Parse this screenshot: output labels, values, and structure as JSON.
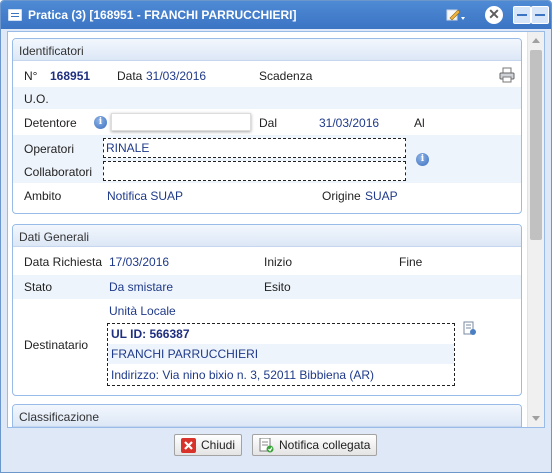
{
  "window": {
    "title": "Pratica (3) [168951 - FRANCHI PARRUCCHIERI]"
  },
  "identificatori": {
    "header": "Identificatori",
    "n_label": "N°",
    "n_value": "168951",
    "data_label": "Data",
    "data_value": "31/03/2016",
    "scadenza_label": "Scadenza",
    "uo_label": "U.O.",
    "detentore_label": "Detentore",
    "dal_label": "Dal",
    "dal_value": "31/03/2016",
    "al_label": "Al",
    "operatori_label": "Operatori",
    "operatori_value": "RINALE",
    "collaboratori_label": "Collaboratori",
    "ambito_label": "Ambito",
    "ambito_value": "Notifica SUAP",
    "origine_label": "Origine",
    "origine_value": "SUAP"
  },
  "dati_generali": {
    "header": "Dati Generali",
    "data_richiesta_label": "Data Richiesta",
    "data_richiesta_value": "17/03/2016",
    "inizio_label": "Inizio",
    "fine_label": "Fine",
    "stato_label": "Stato",
    "stato_value": "Da smistare",
    "esito_label": "Esito",
    "unita_value": "Unità Locale",
    "destinatario_label": "Destinatario",
    "ul_id": "UL ID: 566387",
    "ragione_sociale": "FRANCHI PARRUCCHIERI",
    "indirizzo": "Indirizzo: Via nino bixio n. 3, 52011 Bibbiena (AR)"
  },
  "classificazione": {
    "header": "Classificazione"
  },
  "footer": {
    "chiudi_label": "Chiudi",
    "notifica_label": "Notifica collegata"
  },
  "icons": {
    "info": "info-icon",
    "print": "print-icon",
    "edit": "edit-icon",
    "close": "close-icon"
  },
  "colors": {
    "title_bar": "#3a74c3",
    "value_text": "#1f3a8a",
    "panel_border": "#99bbe8"
  }
}
